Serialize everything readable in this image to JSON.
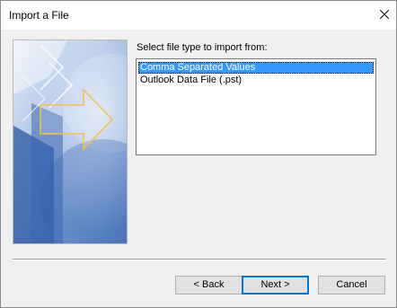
{
  "window": {
    "title": "Import a File",
    "close_icon": "close-icon"
  },
  "banner": {
    "icon": "import-arrow-illustration"
  },
  "file_type": {
    "prompt": "Select file type to import from:",
    "options": [
      "Comma Separated Values",
      "Outlook Data File (.pst)"
    ],
    "selected": "Comma Separated Values"
  },
  "buttons": {
    "back": "< Back",
    "next": "Next >",
    "cancel": "Cancel"
  },
  "colors": {
    "selection": "#3399ff",
    "default_button_border": "#0078d7"
  }
}
